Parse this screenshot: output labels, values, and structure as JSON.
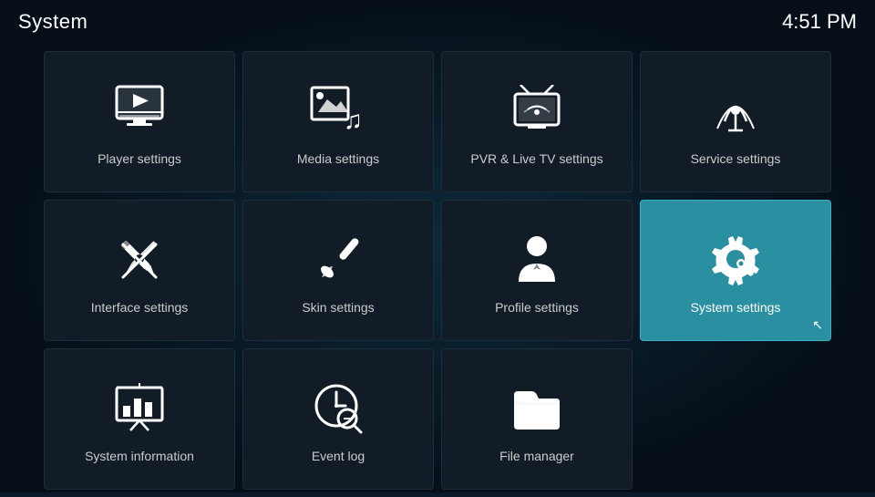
{
  "header": {
    "title": "System",
    "time": "4:51 PM"
  },
  "grid": {
    "items": [
      {
        "id": "player-settings",
        "label": "Player settings",
        "icon": "player",
        "active": false,
        "row": 1,
        "col": 1
      },
      {
        "id": "media-settings",
        "label": "Media settings",
        "icon": "media",
        "active": false,
        "row": 1,
        "col": 2
      },
      {
        "id": "pvr-settings",
        "label": "PVR & Live TV settings",
        "icon": "pvr",
        "active": false,
        "row": 1,
        "col": 3
      },
      {
        "id": "service-settings",
        "label": "Service settings",
        "icon": "service",
        "active": false,
        "row": 1,
        "col": 4
      },
      {
        "id": "interface-settings",
        "label": "Interface settings",
        "icon": "interface",
        "active": false,
        "row": 2,
        "col": 1
      },
      {
        "id": "skin-settings",
        "label": "Skin settings",
        "icon": "skin",
        "active": false,
        "row": 2,
        "col": 2
      },
      {
        "id": "profile-settings",
        "label": "Profile settings",
        "icon": "profile",
        "active": false,
        "row": 2,
        "col": 3
      },
      {
        "id": "system-settings",
        "label": "System settings",
        "icon": "system",
        "active": true,
        "row": 2,
        "col": 4
      },
      {
        "id": "system-information",
        "label": "System information",
        "icon": "info",
        "active": false,
        "row": 3,
        "col": 1
      },
      {
        "id": "event-log",
        "label": "Event log",
        "icon": "eventlog",
        "active": false,
        "row": 3,
        "col": 2
      },
      {
        "id": "file-manager",
        "label": "File manager",
        "icon": "filemanager",
        "active": false,
        "row": 3,
        "col": 3
      }
    ]
  }
}
